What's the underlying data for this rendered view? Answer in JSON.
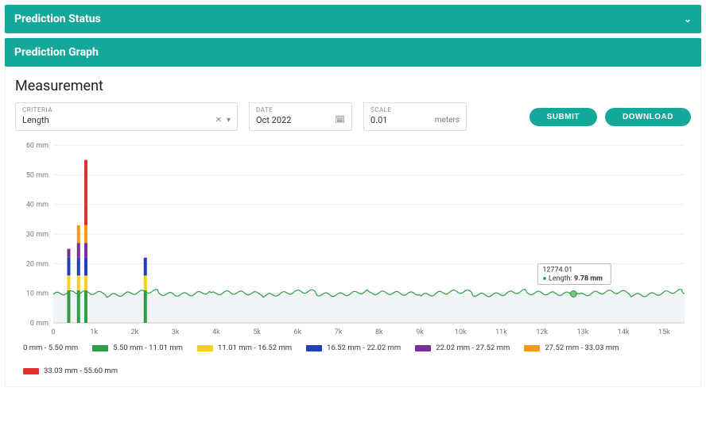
{
  "status_panel": {
    "title": "Prediction Status"
  },
  "graph_panel": {
    "title": "Prediction Graph",
    "section_title": "Measurement",
    "criteria": {
      "label": "CRITERIA",
      "value": "Length"
    },
    "date": {
      "label": "DATE",
      "value": "Oct 2022"
    },
    "scale": {
      "label": "SCALE",
      "value": "0.01",
      "unit": "meters"
    },
    "submit": "SUBMIT",
    "download": "DOWNLOAD"
  },
  "tooltip": {
    "x_value": "12774.01",
    "series_label": "Length:",
    "value": "9.78 mm"
  },
  "chart_data": {
    "type": "line",
    "title": "",
    "xlabel": "",
    "ylabel": "",
    "xlim": [
      0,
      15500
    ],
    "ylim": [
      0,
      60
    ],
    "y_unit": "mm",
    "x_ticks": [
      0,
      1000,
      2000,
      3000,
      4000,
      5000,
      6000,
      7000,
      8000,
      9000,
      10000,
      11000,
      12000,
      13000,
      14000,
      15000
    ],
    "x_tick_labels": [
      "0",
      "1k",
      "2k",
      "3k",
      "4k",
      "5k",
      "6k",
      "7k",
      "8k",
      "9k",
      "10k",
      "11k",
      "12k",
      "13k",
      "14k",
      "15k"
    ],
    "y_ticks": [
      0,
      10,
      20,
      30,
      40,
      50,
      60
    ],
    "y_tick_labels": [
      "0 mm",
      "10 mm",
      "20 mm",
      "30 mm",
      "40 mm",
      "50 mm",
      "60 mm"
    ],
    "baseline": 10,
    "spikes": [
      {
        "x": 380,
        "segments": [
          [
            0,
            11,
            "#2f9e44"
          ],
          [
            11,
            16,
            "#f6d21a"
          ],
          [
            16,
            22,
            "#1f3fbf"
          ],
          [
            22,
            25,
            "#7b2d96"
          ]
        ]
      },
      {
        "x": 620,
        "segments": [
          [
            0,
            11,
            "#2f9e44"
          ],
          [
            11,
            16,
            "#f6d21a"
          ],
          [
            16,
            22,
            "#1f3fbf"
          ],
          [
            22,
            27,
            "#7b2d96"
          ],
          [
            27,
            33,
            "#f39b13"
          ]
        ]
      },
      {
        "x": 800,
        "segments": [
          [
            0,
            11,
            "#2f9e44"
          ],
          [
            11,
            16,
            "#f6d21a"
          ],
          [
            16,
            22,
            "#1f3fbf"
          ],
          [
            22,
            27,
            "#7b2d96"
          ],
          [
            27,
            33,
            "#f39b13"
          ],
          [
            33,
            55,
            "#e03131"
          ]
        ]
      },
      {
        "x": 2260,
        "segments": [
          [
            0,
            11,
            "#2f9e44"
          ],
          [
            11,
            16,
            "#f6d21a"
          ],
          [
            16,
            22,
            "#1f3fbf"
          ]
        ]
      }
    ],
    "hover_point": {
      "x": 12774.01,
      "y": 9.78
    },
    "legend": [
      {
        "label": "0 mm - 5.50 mm",
        "swatch": null
      },
      {
        "label": "5.50 mm - 11.01 mm",
        "swatch": "#2f9e44"
      },
      {
        "label": "11.01 mm - 16.52 mm",
        "swatch": "#f6d21a"
      },
      {
        "label": "16.52 mm - 22.02 mm",
        "swatch": "#1f3fbf"
      },
      {
        "label": "22.02 mm - 27.52 mm",
        "swatch": "#7b2d96"
      },
      {
        "label": "27.52 mm - 33.03 mm",
        "swatch": "#f39b13"
      },
      {
        "label": "33.03 mm - 55.60 mm",
        "swatch": "#e03131"
      }
    ]
  }
}
